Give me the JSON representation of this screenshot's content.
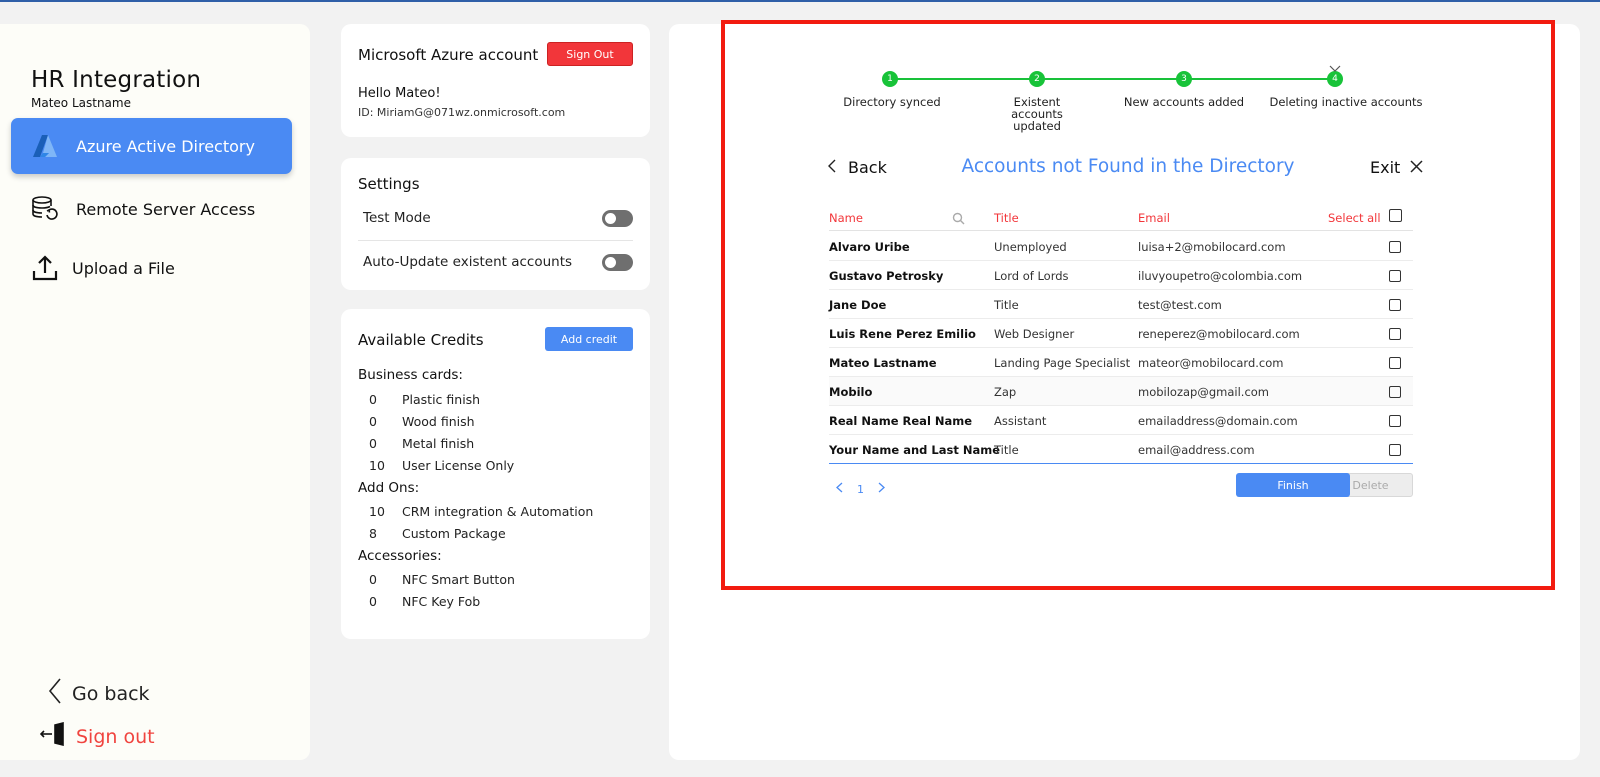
{
  "sidebar": {
    "title": "HR Integration",
    "user": "Mateo Lastname",
    "items": [
      {
        "label": "Azure Active Directory",
        "icon": "azure-logo-icon",
        "active": true
      },
      {
        "label": "Remote Server Access",
        "icon": "database-sync-icon",
        "active": false
      },
      {
        "label": "Upload a File",
        "icon": "upload-icon",
        "active": false
      }
    ],
    "go_back": "Go back",
    "sign_out": "Sign out"
  },
  "azure_card": {
    "title": "Microsoft Azure account",
    "sign_out_label": "Sign Out",
    "greeting": "Hello Mateo!",
    "account_id": "ID: MiriamG@071wz.onmicrosoft.com"
  },
  "settings_card": {
    "title": "Settings",
    "toggles": [
      {
        "label": "Test Mode",
        "on": false
      },
      {
        "label": "Auto-Update existent accounts",
        "on": false
      }
    ]
  },
  "credits_card": {
    "title": "Available Credits",
    "add_label": "Add credit",
    "groups": [
      {
        "name": "Business cards:",
        "items": [
          {
            "qty": "0",
            "label": "Plastic finish"
          },
          {
            "qty": "0",
            "label": "Wood finish"
          },
          {
            "qty": "0",
            "label": "Metal finish"
          },
          {
            "qty": "10",
            "label": "User License Only"
          }
        ]
      },
      {
        "name": "Add Ons:",
        "items": [
          {
            "qty": "10",
            "label": "CRM integration & Automation"
          },
          {
            "qty": "8",
            "label": "Custom Package"
          }
        ]
      },
      {
        "name": "Accessories:",
        "items": [
          {
            "qty": "0",
            "label": "NFC Smart Button"
          },
          {
            "qty": "0",
            "label": "NFC Key Fob"
          }
        ]
      }
    ]
  },
  "stepper": {
    "steps": [
      {
        "num": "1",
        "label": "Directory synced"
      },
      {
        "num": "2",
        "label": "Existent accounts updated"
      },
      {
        "num": "3",
        "label": "New accounts added"
      },
      {
        "num": "4",
        "label": "Deleting inactive accounts"
      }
    ],
    "color": "#19c13a"
  },
  "accounts": {
    "back_label": "Back",
    "title": "Accounts not Found in the Directory",
    "exit_label": "Exit",
    "columns": {
      "name": "Name",
      "title": "Title",
      "email": "Email",
      "select_all": "Select all"
    },
    "rows": [
      {
        "name": "Alvaro Uribe",
        "title": "Unemployed",
        "email": "luisa+2@mobilocard.com"
      },
      {
        "name": "Gustavo Petrosky",
        "title": "Lord of Lords",
        "email": "iluvyoupetro@colombia.com"
      },
      {
        "name": "Jane Doe",
        "title": "Title",
        "email": "test@test.com"
      },
      {
        "name": "Luis Rene Perez Emilio",
        "title": "Web Designer",
        "email": "reneperez@mobilocard.com"
      },
      {
        "name": "Mateo Lastname",
        "title": "Landing Page Specialist",
        "email": "mateor@mobilocard.com"
      },
      {
        "name": "Mobilo",
        "title": "Zap",
        "email": "mobilozap@gmail.com"
      },
      {
        "name": "Real Name Real Name",
        "title": "Assistant",
        "email": "emailaddress@domain.com"
      },
      {
        "name": "Your Name and Last Name",
        "title": "Title",
        "email": "email@address.com"
      }
    ],
    "page": "1",
    "finish_label": "Finish",
    "delete_label": "Delete"
  },
  "colors": {
    "accent": "#4a8af3",
    "danger": "#f2363a",
    "highlight_frame": "#f21b0f"
  }
}
